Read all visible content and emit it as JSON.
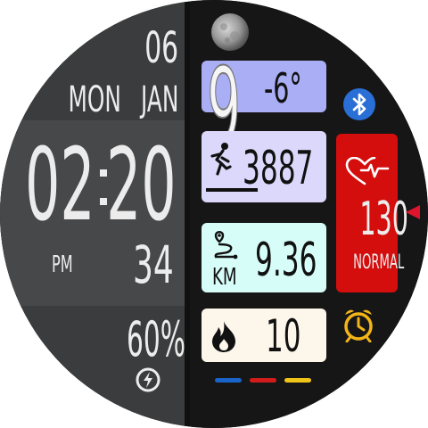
{
  "date": {
    "day": "06",
    "weekday": "MON",
    "month": "JAN"
  },
  "time": {
    "hours": "02",
    "separator": ":",
    "minutes": "20",
    "ampm": "PM",
    "seconds": "34"
  },
  "battery": {
    "percent": "60",
    "percent_sign": "%",
    "icon": "charging-bolt-icon"
  },
  "weather": {
    "condition_code": "9",
    "temperature": "-6°",
    "card_color": "#a9aef5"
  },
  "moon": {
    "icon": "moon-phase-icon"
  },
  "bluetooth": {
    "icon": "bluetooth-icon",
    "color": "#2a6fd6"
  },
  "steps": {
    "value": "3887",
    "icon": "runner-icon",
    "card_color": "#dcd8fc"
  },
  "distance": {
    "value": "9.36",
    "unit": "KM",
    "icon": "route-icon",
    "card_color": "#d6fdf8"
  },
  "calories": {
    "value": "10",
    "icon": "flame-icon",
    "card_color": "#fdf6ea"
  },
  "heart": {
    "bpm": "130",
    "status": "NORMAL",
    "icon": "heart-rate-icon",
    "card_color": "#d40d0d"
  },
  "alarm": {
    "icon": "alarm-clock-icon",
    "color": "#f2b418"
  },
  "color_dots": [
    "#1a63c8",
    "#d21c1c",
    "#f0c419"
  ],
  "pointer": {
    "icon": "pointer-triangle-icon",
    "color": "#e0142c"
  }
}
